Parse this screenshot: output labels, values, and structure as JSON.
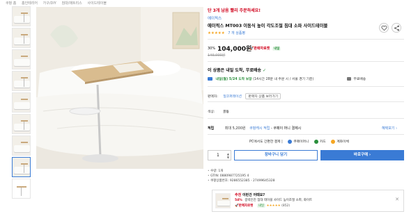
{
  "breadcrumb": [
    "쿠팡 홈",
    "홈인테리어",
    "가구/DIY",
    "침대/매트리스",
    "사이드테이블"
  ],
  "product": {
    "urgency": "단 3개 남음 빨리 주문하세요!",
    "brand": "에이픽스",
    "title": "에이픽스 MT003 이동식 높이 각도조절 침대 소파 사이드테이블",
    "stars": "★★★★★",
    "review_count": "7 개 상품평",
    "discount": "30%",
    "price": "104,000원",
    "rocket_label": "🚀판매자로켓",
    "rocket_badge": "내일",
    "original_price": "149,000원"
  },
  "delivery": {
    "headline": "이 상품은 내일 도착, 무료배송",
    "check": "✓",
    "arrival": "내일(월) 5/24 도착 보장",
    "detail": "(14시간 28분 내 주문 시 / 서울 경기 기준)",
    "return": "무료배송"
  },
  "seller": {
    "label": "판매자:",
    "name": "일코퍼레이션",
    "button": "판매자 상품 보러가기"
  },
  "option": {
    "label": "색상:",
    "value": "골동"
  },
  "benefit": {
    "label": "적립",
    "text": "최대 5,200원",
    "link1": "쿠팡캐시 적립",
    "link2": "- 쿠페이 머니 결제시",
    "more": "혜택보기 ›"
  },
  "payment": {
    "label": "PC에서도 간편한 결제 |",
    "methods": [
      "쿠페이머니",
      "카드",
      "계좌이체"
    ],
    "colors": [
      "#3a7bd5",
      "#2a8f3c",
      "#f5a623"
    ]
  },
  "purchase": {
    "quantity": "1",
    "cart_label": "장바구니 담기",
    "buy_label": "바로구매 ›"
  },
  "specs": [
    "수량: 1개",
    "GTIN: 0880987725195 4",
    "쿠팡상품번호: 9286552385 - 27499645328"
  ],
  "recommendation": {
    "prefix": "추천",
    "title": "이런건 어때요?",
    "discount": "54%",
    "name": "중박인진 침대 테이블 사이드 높이조절 소파, 화이트",
    "rocket": "🚀판매자로켓",
    "badge": "내일",
    "stars": "★★★★★",
    "count": "(852)",
    "close": "✕"
  }
}
